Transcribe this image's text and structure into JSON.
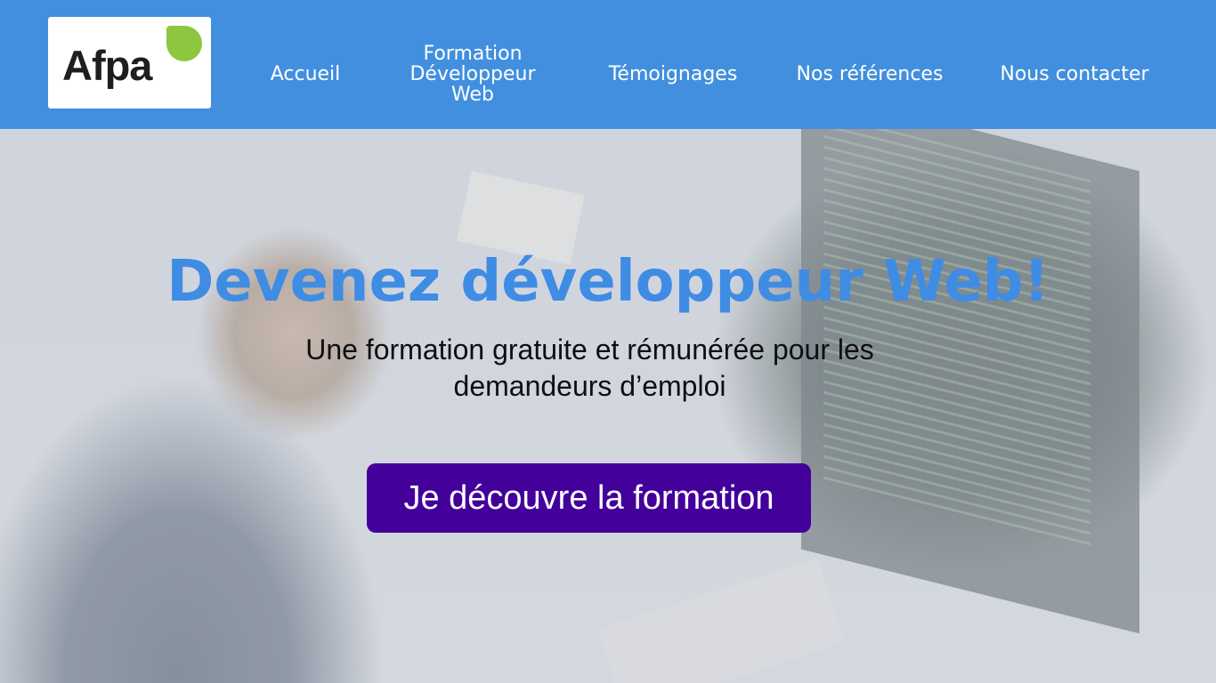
{
  "header": {
    "logo_text": "Afpa",
    "nav": [
      {
        "label": "Accueil"
      },
      {
        "label": "Formation Développeur Web"
      },
      {
        "label": "Témoignages"
      },
      {
        "label": "Nos références"
      },
      {
        "label": "Nous contacter"
      }
    ]
  },
  "hero": {
    "title": "Devenez développeur Web!",
    "subtitle": "Une formation gratuite et rémunérée pour les demandeurs d’emploi",
    "cta_label": "Je découvre la formation"
  },
  "colors": {
    "header_bg": "#428fdf",
    "title": "#3f8ce4",
    "cta_bg": "#43009b",
    "logo_leaf": "#8dc63f"
  }
}
